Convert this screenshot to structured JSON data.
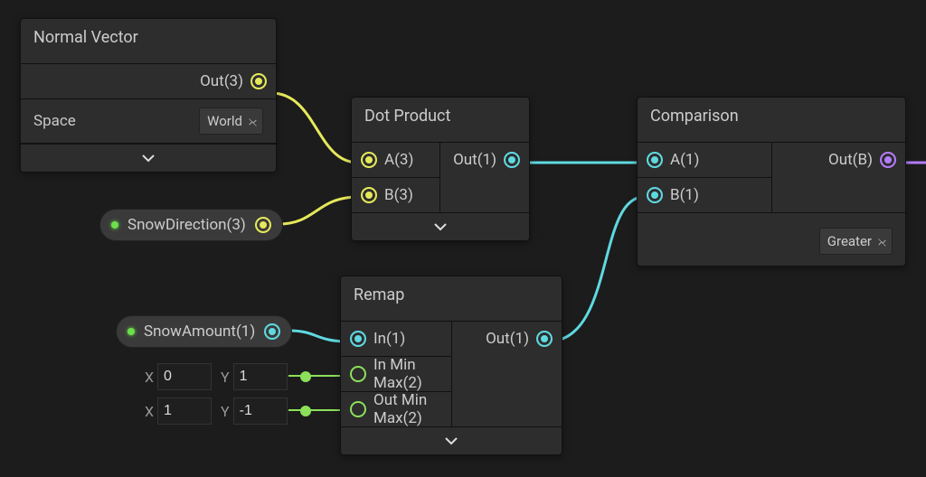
{
  "colors": {
    "vec3": "#e5e85a",
    "scalar": "#5fd9e0",
    "bool": "#b47cff",
    "param": "#8de05a"
  },
  "nodes": {
    "normal": {
      "title": "Normal Vector",
      "out": "Out(3)",
      "prop_label": "Space",
      "prop_value": "World"
    },
    "dot": {
      "title": "Dot Product",
      "inA": "A(3)",
      "inB": "B(3)",
      "out": "Out(1)"
    },
    "comp": {
      "title": "Comparison",
      "inA": "A(1)",
      "inB": "B(1)",
      "out": "Out(B)",
      "mode": "Greater"
    },
    "remap": {
      "title": "Remap",
      "in": "In(1)",
      "inmm": "In Min Max(2)",
      "outmm": "Out Min Max(2)",
      "out": "Out(1)"
    }
  },
  "params": {
    "snowdir": "SnowDirection(3)",
    "snowamt": "SnowAmount(1)"
  },
  "inline": {
    "inmm": {
      "xlabel": "X",
      "x": "0",
      "ylabel": "Y",
      "y": "1"
    },
    "outmm": {
      "xlabel": "X",
      "x": "1",
      "ylabel": "Y",
      "y": "-1"
    }
  }
}
